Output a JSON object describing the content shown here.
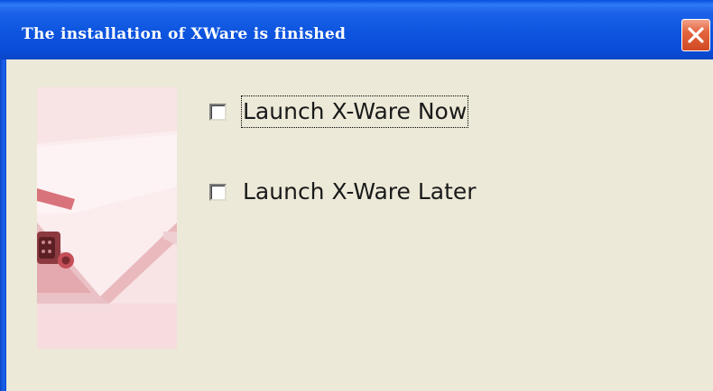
{
  "window": {
    "title": "The installation of XWare is finished",
    "close_icon": "close-icon"
  },
  "sidebar": {
    "image_icon": "serial-port-device-image"
  },
  "options": [
    {
      "label": "Launch X-Ware Now",
      "checked": false,
      "focused": true
    },
    {
      "label": "Launch X-Ware Later",
      "checked": false,
      "focused": false
    }
  ],
  "colors": {
    "titlebar_blue": "#0a4dd8",
    "close_red": "#e3643e",
    "window_bg": "#ece9d8",
    "image_tint": "#f7e0e2"
  }
}
